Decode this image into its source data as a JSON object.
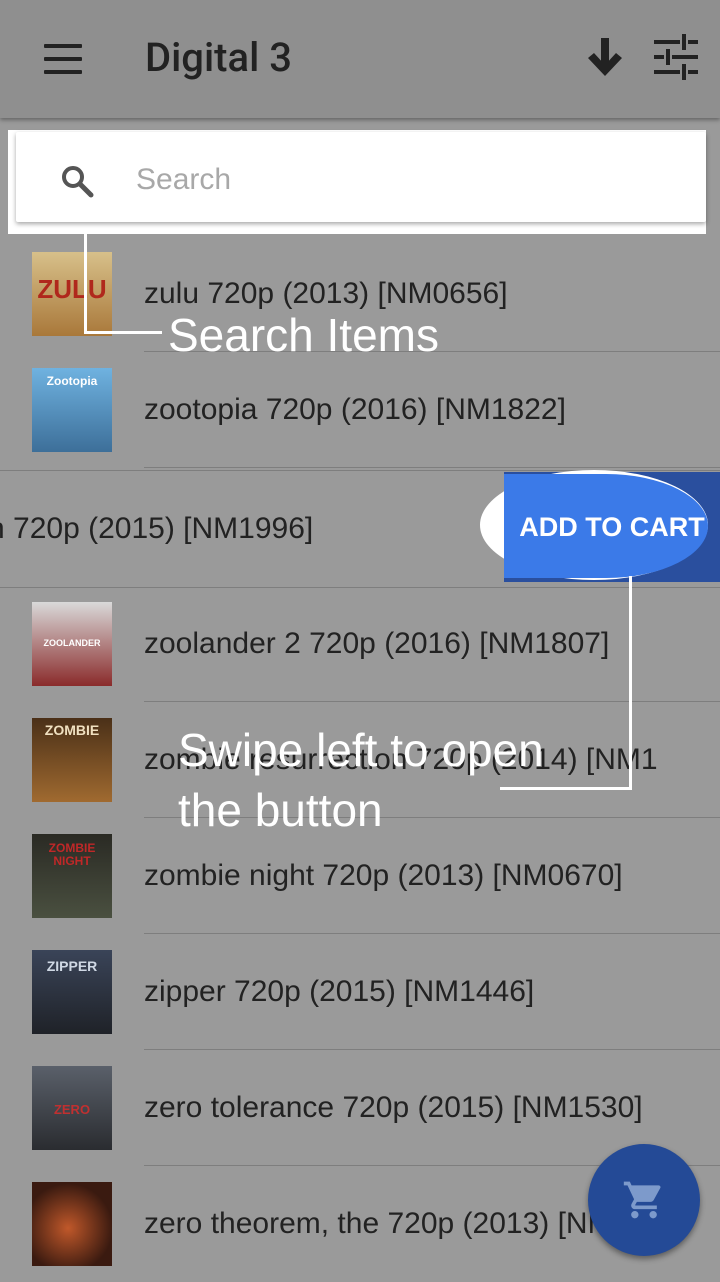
{
  "app_bar": {
    "title": "Digital 3",
    "menu_icon": "menu-icon",
    "sort_icon": "arrow-down-icon",
    "filter_icon": "tune-icon"
  },
  "search": {
    "placeholder": "Search",
    "value": ""
  },
  "list": {
    "items": [
      {
        "label": "zulu 720p (2013) [NM0656]",
        "poster_text": "ZULU",
        "poster_color": "#c9a45a"
      },
      {
        "label": "zootopia 720p (2016) [NM1822]",
        "poster_text": "Zootopia",
        "poster_color": "#4a8fc4"
      },
      {
        "label": "zoolander 2 720p (2016) [NM1807]",
        "poster_text": "ZOOLANDER",
        "poster_color": "#8a2b2b"
      },
      {
        "label": "zombie resurrection 720p (2014) [NM1",
        "poster_text": "ZOMBIE",
        "poster_color": "#6b4a2a"
      },
      {
        "label": "zombie night 720p (2013) [NM0670]",
        "poster_text": "ZOMBIE NIGHT",
        "poster_color": "#3a3a32"
      },
      {
        "label": "zipper 720p (2015) [NM1446]",
        "poster_text": "ZIPPER",
        "poster_color": "#2d3440"
      },
      {
        "label": "zero tolerance 720p (2015) [NM1530]",
        "poster_text": "ZERO",
        "poster_color": "#3b4048"
      },
      {
        "label": "zero theorem, the 720p (2013) [NM",
        "poster_text": "",
        "poster_color": "#5a2a18"
      }
    ],
    "swiped_item": {
      "label": "n 720p (2015) [NM1996]",
      "action_label": "ADD TO CART"
    }
  },
  "annotations": {
    "search_hint": "Search Items",
    "swipe_hint_line1": "Swipe left to open",
    "swipe_hint_line2": "the button"
  },
  "fab": {
    "icon": "shopping-cart-icon"
  },
  "colors": {
    "scrim": "#9a9a9a",
    "action_blue": "#3b7ae8",
    "fab_blue": "#244a96"
  }
}
